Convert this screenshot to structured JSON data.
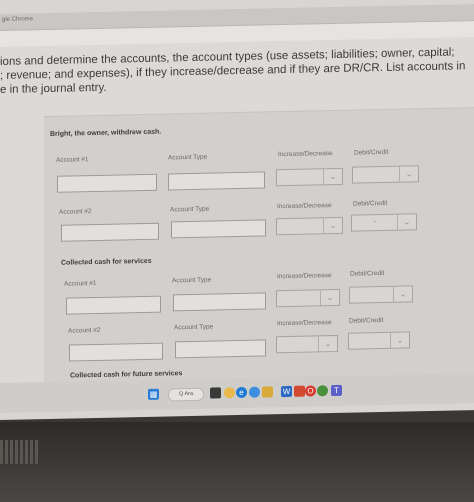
{
  "browser": {
    "title": "gle Chrome"
  },
  "instructions": {
    "line1": "ions and determine the accounts, the account types (use assets; liabilities; owner, capital;",
    "line2": "; revenue; and expenses), if they increase/decrease and if they are DR/CR. List accounts in",
    "line3": "e in the journal entry."
  },
  "transactions": [
    {
      "title": "Bright, the owner, withdrew cash.",
      "rows": [
        {
          "account_label": "Account #1",
          "type_label": "Account Type",
          "incdec_label": "Increase/Decrease",
          "drcr_label": "Debit/Credit",
          "drcr_value": ""
        },
        {
          "account_label": "Account #2",
          "type_label": "Account Type",
          "incdec_label": "Increase/Decrease",
          "drcr_label": "Debit/Credit",
          "drcr_value": "-"
        }
      ]
    },
    {
      "title": "Collected cash for services",
      "rows": [
        {
          "account_label": "Account #1",
          "type_label": "Account Type",
          "incdec_label": "Increase/Decrease",
          "drcr_label": "Debit/Credit",
          "drcr_value": ""
        },
        {
          "account_label": "Account #2",
          "type_label": "Account Type",
          "incdec_label": "Increase/Decrease",
          "drcr_label": "Debit/Credit",
          "drcr_value": ""
        }
      ]
    },
    {
      "title": "Collected cash for future services"
    }
  ],
  "taskbar": {
    "search_text": "Q Ara",
    "icons": [
      "windows-icon",
      "search-icon",
      "file-explorer-icon",
      "cortana-icon",
      "edge-icon",
      "chrome-icon",
      "folder-icon",
      "word-icon",
      "office-icon",
      "opera-icon",
      "chrome-icon-2",
      "teams-icon"
    ]
  }
}
